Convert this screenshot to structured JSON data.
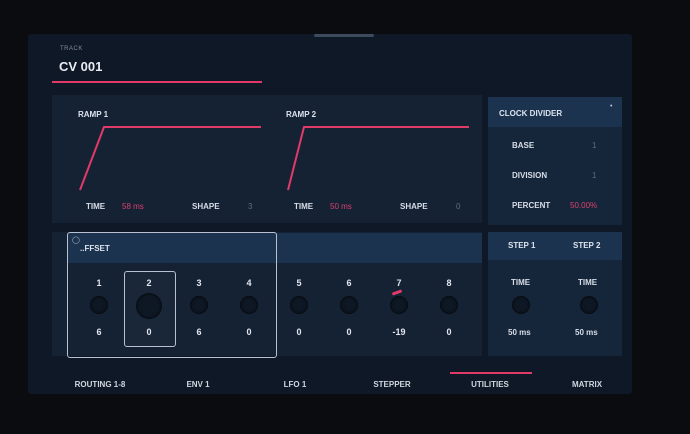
{
  "header": {
    "track_label": "TRACK",
    "track_name": "CV 001"
  },
  "ramp1": {
    "title": "RAMP 1",
    "time_label": "TIME",
    "time_value": "58 ms",
    "shape_label": "SHAPE",
    "shape_value": "3"
  },
  "ramp2": {
    "title": "RAMP 2",
    "time_label": "TIME",
    "time_value": "50 ms",
    "shape_label": "SHAPE",
    "shape_value": "0"
  },
  "clock": {
    "title": "CLOCK DIVIDER",
    "base_label": "BASE",
    "base_value": "1",
    "division_label": "DIVISION",
    "division_value": "1",
    "percent_label": "PERCENT",
    "percent_value": "50.00%"
  },
  "offset": {
    "title": "..FFSET",
    "columns": [
      {
        "num": "1",
        "value": "6"
      },
      {
        "num": "2",
        "value": "0"
      },
      {
        "num": "3",
        "value": "6"
      },
      {
        "num": "4",
        "value": "0"
      },
      {
        "num": "5",
        "value": "0"
      },
      {
        "num": "6",
        "value": "0"
      },
      {
        "num": "7",
        "value": "-19"
      },
      {
        "num": "8",
        "value": "0"
      }
    ]
  },
  "steps": [
    {
      "title": "STEP 1",
      "time_label": "TIME",
      "time_value": "50 ms"
    },
    {
      "title": "STEP 2",
      "time_label": "TIME",
      "time_value": "50 ms"
    }
  ],
  "tabs": [
    {
      "label": "ROUTING 1-8"
    },
    {
      "label": "ENV 1"
    },
    {
      "label": "LFO 1"
    },
    {
      "label": "STEPPER"
    },
    {
      "label": "UTILITIES"
    },
    {
      "label": "MATRIX"
    }
  ],
  "active_tab": "UTILITIES",
  "colors": {
    "accent": "#e23a68",
    "panel": "#152234",
    "band": "#1c3350",
    "background": "#0f1826"
  }
}
